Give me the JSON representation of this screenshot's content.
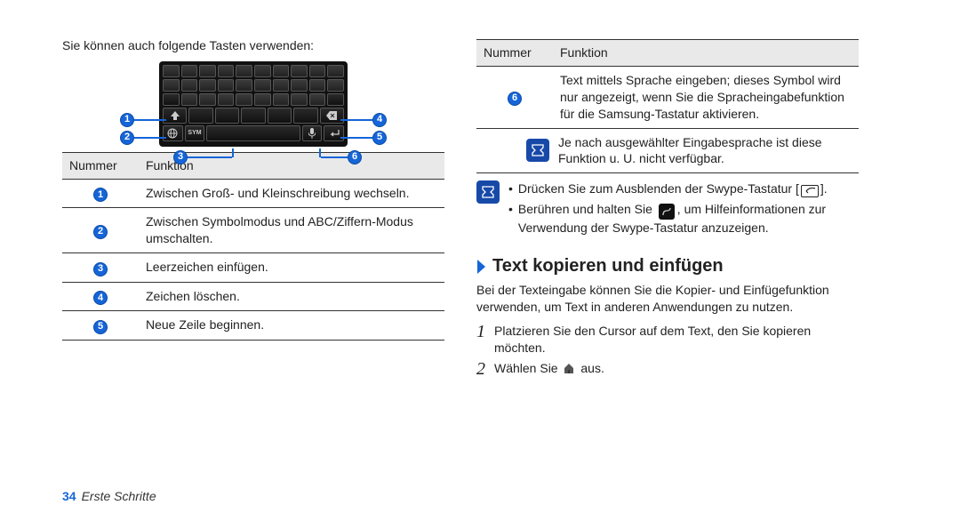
{
  "left": {
    "intro": "Sie können auch folgende Tasten verwenden:",
    "table_headers": {
      "num": "Nummer",
      "func": "Funktion"
    },
    "rows": [
      {
        "n": "1",
        "t": "Zwischen Groß- und Kleinschreibung wechseln."
      },
      {
        "n": "2",
        "t": "Zwischen Symbolmodus und ABC/Ziffern-Modus umschalten."
      },
      {
        "n": "3",
        "t": "Leerzeichen einfügen."
      },
      {
        "n": "4",
        "t": "Zeichen löschen."
      },
      {
        "n": "5",
        "t": "Neue Zeile beginnen."
      }
    ],
    "callouts": {
      "c1": "1",
      "c2": "2",
      "c3": "3",
      "c4": "4",
      "c5": "5",
      "c6": "6"
    }
  },
  "right": {
    "table_headers": {
      "num": "Nummer",
      "func": "Funktion"
    },
    "row6": {
      "n": "6",
      "t": "Text mittels Sprache eingeben; dieses Symbol wird nur angezeigt, wenn Sie die Spracheingabefunktion für die Samsung-Tastatur aktivieren."
    },
    "row6_note": "Je nach ausgewählter Eingabesprache ist diese Funktion u. U. nicht verfügbar.",
    "note1_a": "Drücken Sie zum Ausblenden der Swype-Tastatur [",
    "note1_b": "].",
    "note2_a": "Berühren und halten Sie",
    "note2_b": ", um Hilfeinformationen zur Verwendung der Swype-Tastatur anzuzeigen.",
    "section_title": "Text kopieren und einfügen",
    "section_para": "Bei der Texteingabe können Sie die Kopier- und Einfügefunktion verwenden, um Text in anderen Anwendungen zu nutzen.",
    "step1_n": "1",
    "step1_t": "Platzieren Sie den Cursor auf dem Text, den Sie kopieren möchten.",
    "step2_n": "2",
    "step2_a": "Wählen Sie",
    "step2_b": "aus."
  },
  "footer": {
    "page": "34",
    "chapter": "Erste Schritte"
  }
}
